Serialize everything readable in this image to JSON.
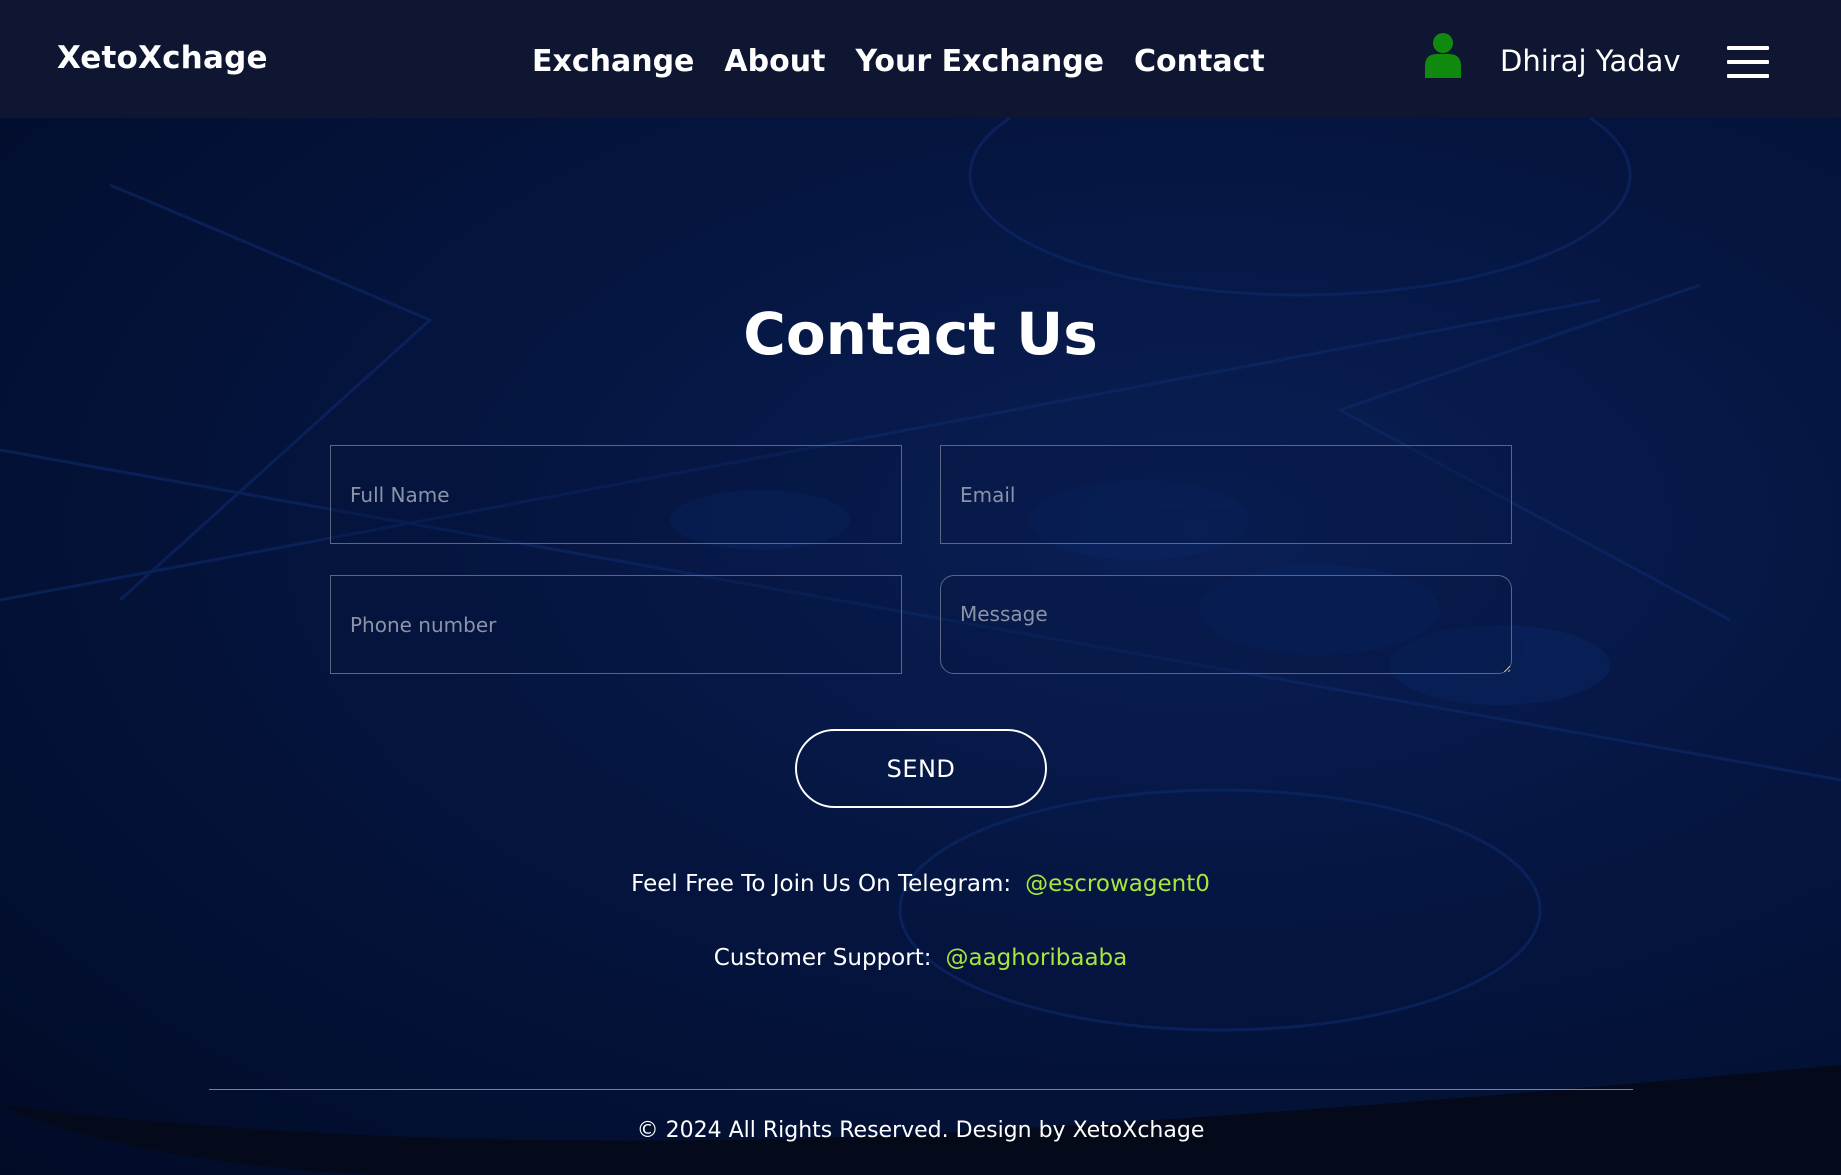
{
  "header": {
    "brand": "XetoXchage",
    "nav": [
      "Exchange",
      "About",
      "Your Exchange",
      "Contact"
    ],
    "user_name": "Dhiraj Yadav",
    "user_icon": "user-icon",
    "menu_icon": "hamburger-menu-icon"
  },
  "main": {
    "title": "Contact Us",
    "form": {
      "full_name_placeholder": "Full Name",
      "email_placeholder": "Email",
      "phone_placeholder": "Phone number",
      "message_placeholder": "Message",
      "send_label": "SEND"
    },
    "telegram": {
      "label": "Feel Free To Join Us On Telegram:",
      "handle": "@escrowagent0"
    },
    "support": {
      "label": "Customer Support:",
      "handle": "@aaghoribaaba"
    }
  },
  "footer": {
    "copyright": "© 2024 All Rights Reserved. Design by XetoXchage"
  },
  "colors": {
    "header_bg": "#0f1631",
    "page_bg": "#031033",
    "accent_handle": "#a8e63b",
    "user_icon": "#0f8a0f"
  }
}
